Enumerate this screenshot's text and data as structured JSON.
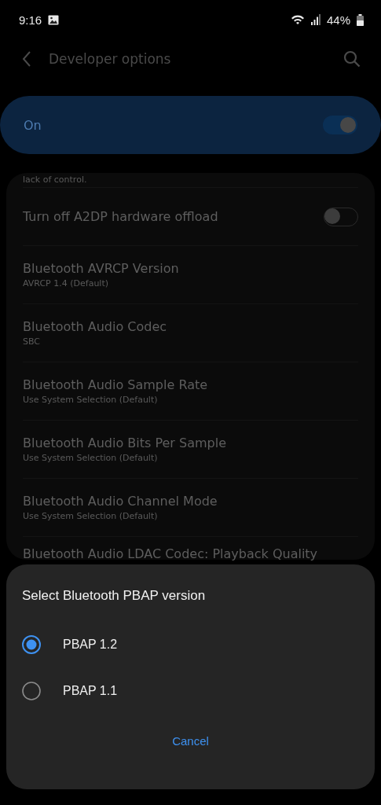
{
  "status_bar": {
    "time": "9:16",
    "battery": "44%"
  },
  "header": {
    "title": "Developer options"
  },
  "master_switch": {
    "label": "On",
    "on": true
  },
  "settings": {
    "partial_text": "lack of control.",
    "items": [
      {
        "kind": "switch",
        "title": "Turn off A2DP hardware offload",
        "on": false
      },
      {
        "kind": "value",
        "title": "Bluetooth AVRCP Version",
        "value": "AVRCP 1.4 (Default)"
      },
      {
        "kind": "value",
        "title": "Bluetooth Audio Codec",
        "value": "SBC"
      },
      {
        "kind": "value",
        "title": "Bluetooth Audio Sample Rate",
        "value": "Use System Selection (Default)"
      },
      {
        "kind": "value",
        "title": "Bluetooth Audio Bits Per Sample",
        "value": "Use System Selection (Default)"
      },
      {
        "kind": "value",
        "title": "Bluetooth Audio Channel Mode",
        "value": "Use System Selection (Default)"
      },
      {
        "kind": "value",
        "title": "Bluetooth Audio LDAC Codec: Playback Quality"
      }
    ]
  },
  "dialog": {
    "title": "Select Bluetooth PBAP version",
    "options": [
      {
        "label": "PBAP 1.2",
        "selected": true
      },
      {
        "label": "PBAP 1.1",
        "selected": false
      }
    ],
    "cancel": "Cancel"
  }
}
